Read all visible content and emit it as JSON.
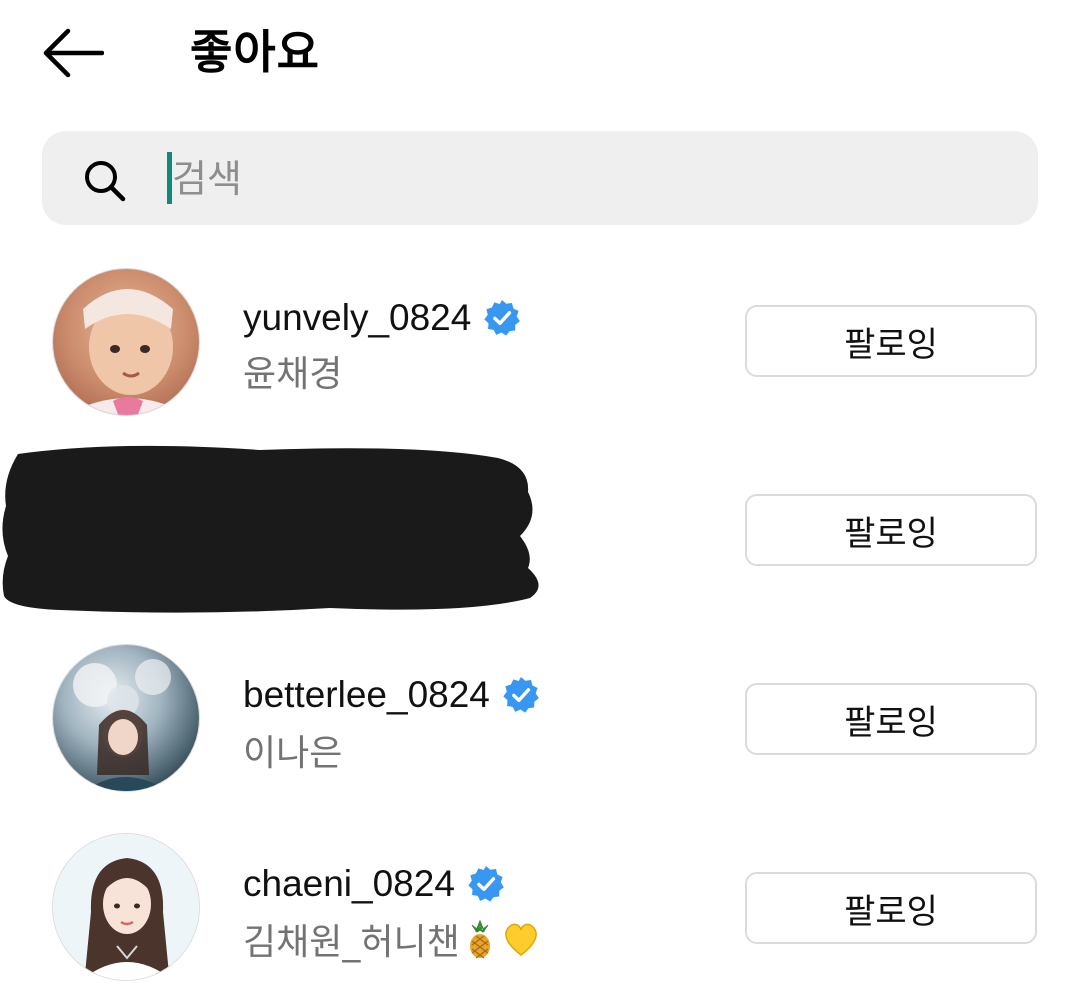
{
  "header": {
    "title": "좋아요",
    "back_icon": "arrow-left-icon"
  },
  "search": {
    "placeholder": "검색",
    "value": "",
    "icon": "search-icon"
  },
  "accent_colors": {
    "verified": "#3897f0",
    "caret": "#138a79",
    "button_border": "#dbdbdb",
    "search_bg": "#efefef"
  },
  "likes": [
    {
      "username": "yunvely_0824",
      "full_name": "윤채경",
      "verified": true,
      "button_label": "팔로잉"
    },
    {
      "username": "",
      "full_name": "",
      "verified": false,
      "redacted": true,
      "button_label": "팔로잉"
    },
    {
      "username": "betterlee_0824",
      "full_name": "이나은",
      "verified": true,
      "button_label": "팔로잉"
    },
    {
      "username": "chaeni_0824",
      "full_name": "김채원_허니챈",
      "full_name_emojis": [
        "pineapple-emoji",
        "yellow-heart-emoji"
      ],
      "verified": true,
      "button_label": "팔로잉"
    }
  ]
}
